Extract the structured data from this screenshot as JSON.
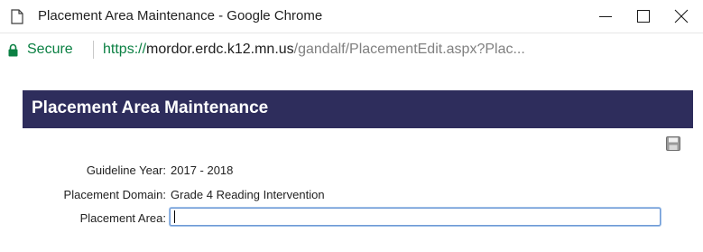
{
  "window": {
    "title": "Placement Area Maintenance - Google Chrome"
  },
  "addressbar": {
    "secure_label": "Secure",
    "url_scheme": "https://",
    "url_host": "mordor.erdc.k12.mn.us",
    "url_path": "/gandalf/PlacementEdit.aspx?Plac..."
  },
  "page": {
    "header_title": "Placement Area Maintenance",
    "fields": {
      "guideline_year_label": "Guideline Year:",
      "guideline_year_value": "2017 - 2018",
      "placement_domain_label": "Placement Domain:",
      "placement_domain_value": "Grade 4 Reading Intervention",
      "placement_area_label": "Placement Area:",
      "placement_area_value": ""
    }
  },
  "colors": {
    "header_bg": "#2e2d5c",
    "secure_green": "#0b8043",
    "input_focus_border": "#6f9ad6"
  },
  "icons": {
    "page": "document-icon",
    "minimize": "minimize-icon",
    "maximize": "maximize-icon",
    "close": "close-icon",
    "lock": "lock-icon",
    "save": "save-icon"
  }
}
